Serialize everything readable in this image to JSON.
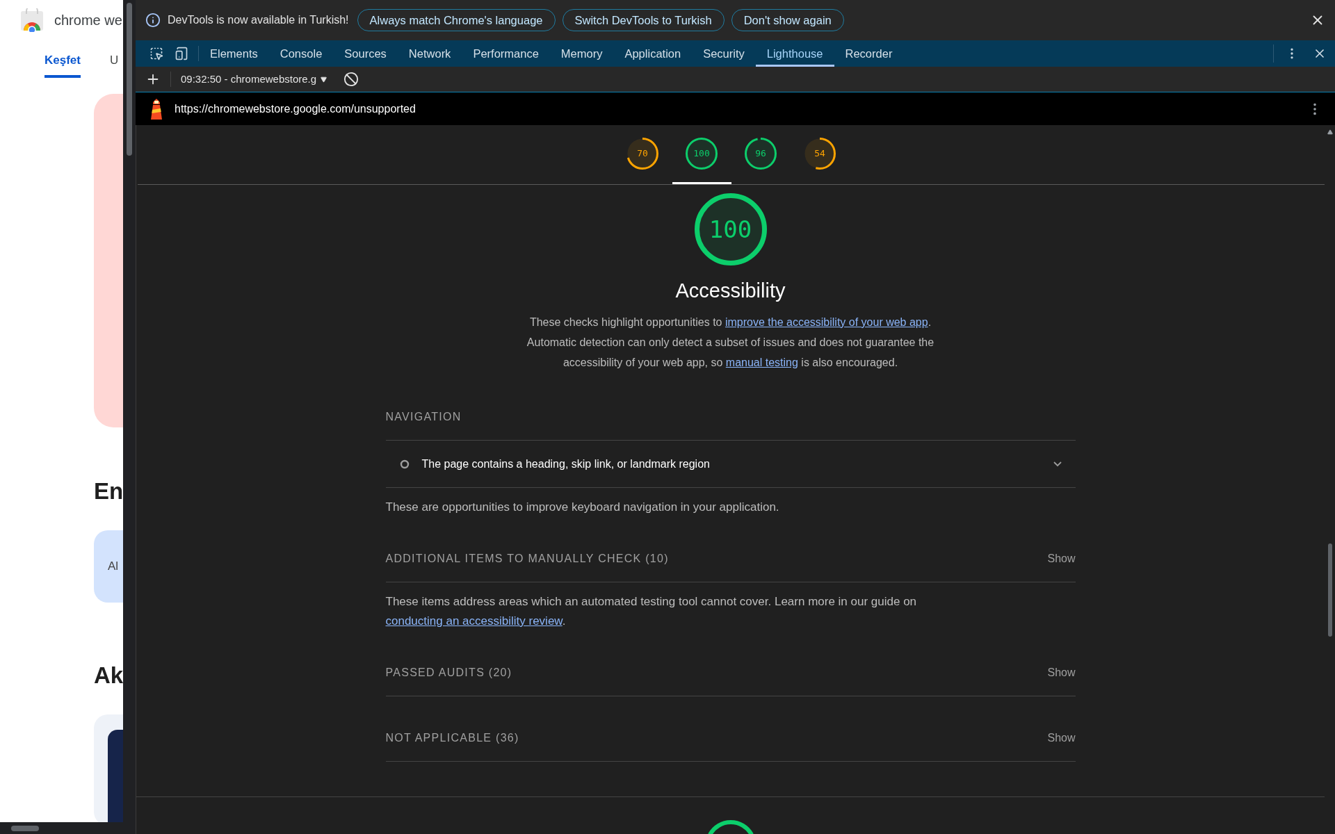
{
  "page": {
    "title": "chrome we",
    "tabs": [
      {
        "label": "Keşfet",
        "selected": true
      },
      {
        "label": "U",
        "selected": false
      }
    ],
    "headings": [
      "En",
      "Ak"
    ],
    "chip": "Al"
  },
  "devtools": {
    "infobar": {
      "message": "DevTools is now available in Turkish!",
      "buttons": [
        "Always match Chrome's language",
        "Switch DevTools to Turkish",
        "Don't show again"
      ]
    },
    "tabs": [
      {
        "label": "Elements",
        "selected": false
      },
      {
        "label": "Console",
        "selected": false
      },
      {
        "label": "Sources",
        "selected": false
      },
      {
        "label": "Network",
        "selected": false
      },
      {
        "label": "Performance",
        "selected": false
      },
      {
        "label": "Memory",
        "selected": false
      },
      {
        "label": "Application",
        "selected": false
      },
      {
        "label": "Security",
        "selected": false
      },
      {
        "label": "Lighthouse",
        "selected": true
      },
      {
        "label": "Recorder",
        "selected": false
      }
    ],
    "session": "09:32:50 - chromewebstore.g",
    "url": "https://chromewebstore.google.com/unsupported",
    "report": {
      "gauges": [
        {
          "score": "70",
          "color": "#ffa400",
          "selected": false
        },
        {
          "score": "100",
          "color": "#0cce6b",
          "selected": true
        },
        {
          "score": "96",
          "color": "#0cce6b",
          "selected": false
        },
        {
          "score": "54",
          "color": "#ffa400",
          "selected": false
        }
      ],
      "category": {
        "score": "100",
        "color": "#0cce6b",
        "title": "Accessibility",
        "description": [
          {
            "text": "These checks highlight opportunities to "
          },
          {
            "text": "improve the accessibility of your web app",
            "kind": "link"
          },
          {
            "text": ". Automatic detection can only detect a subset of issues and does not guarantee the accessibility of your web app, so "
          },
          {
            "text": "manual testing",
            "kind": "link"
          },
          {
            "text": " is also encouraged."
          }
        ]
      },
      "groups": [
        {
          "title": "NAVIGATION",
          "audits": [
            {
              "text": "The page contains a heading, skip link, or landmark region",
              "expanded": false
            }
          ],
          "description": [
            {
              "text": "These are opportunities to improve keyboard navigation in your application."
            }
          ]
        },
        {
          "title": "ADDITIONAL ITEMS TO MANUALLY CHECK (10)",
          "toggle": "Show",
          "description": [
            {
              "text": "These items address areas which an automated testing tool cannot cover. Learn more in our guide on "
            },
            {
              "text": "conducting an accessibility review",
              "kind": "link"
            },
            {
              "text": "."
            }
          ]
        },
        {
          "title": "PASSED AUDITS (20)",
          "toggle": "Show"
        },
        {
          "title": "NOT APPLICABLE (36)",
          "toggle": "Show"
        }
      ],
      "next_gauge": {
        "color": "#0cce6b"
      }
    }
  }
}
